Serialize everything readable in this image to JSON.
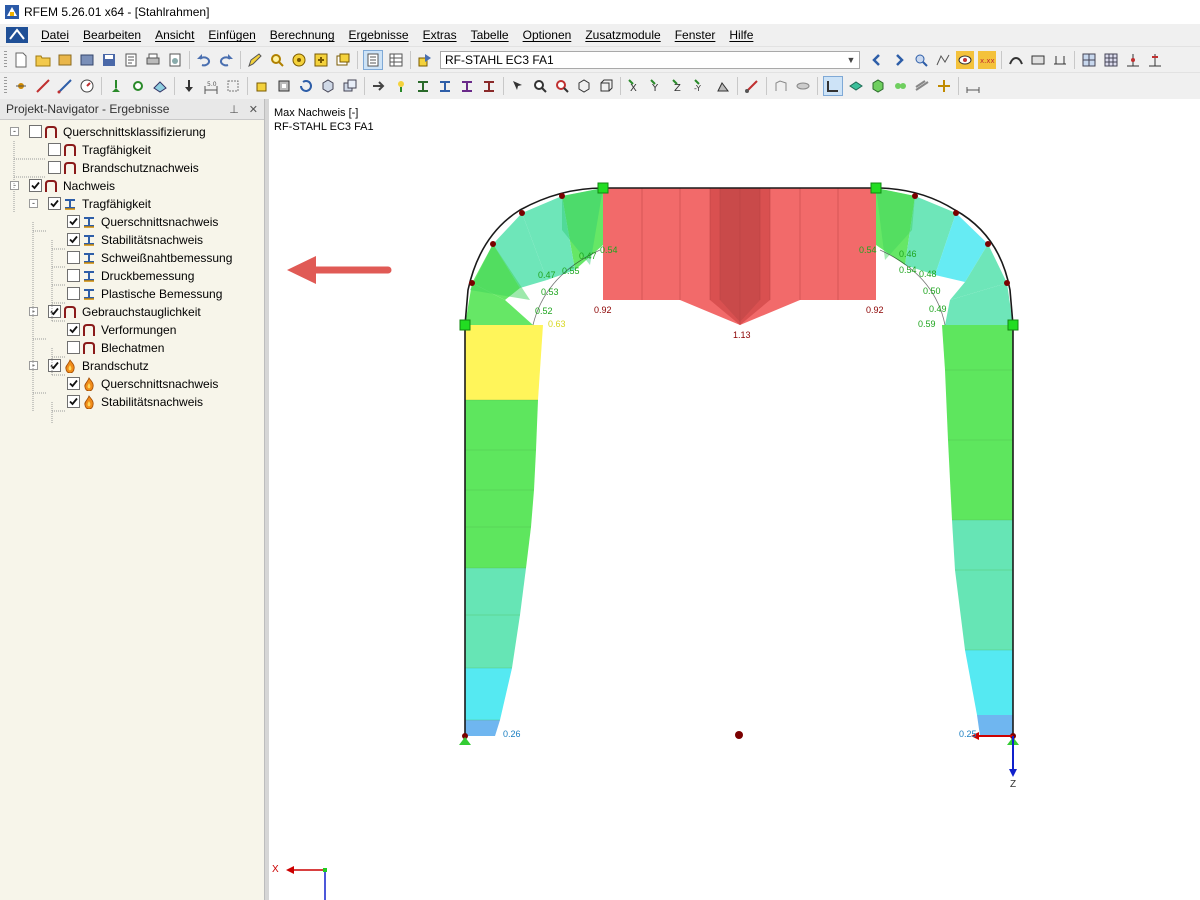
{
  "window": {
    "title": "RFEM 5.26.01 x64 - [Stahlrahmen]"
  },
  "menu": [
    "Datei",
    "Bearbeiten",
    "Ansicht",
    "Einfügen",
    "Berechnung",
    "Ergebnisse",
    "Extras",
    "Tabelle",
    "Optionen",
    "Zusatzmodule",
    "Fenster",
    "Hilfe"
  ],
  "toolbar": {
    "case_select": "RF-STAHL EC3 FA1"
  },
  "navigator": {
    "title": "Projekt-Navigator - Ergebnisse",
    "items": [
      {
        "label": "Querschnittsklassifizierung",
        "level": 0,
        "expander": "-",
        "checked": false,
        "icon": "frame-icon"
      },
      {
        "label": "Tragfähigkeit",
        "level": 1,
        "expander": "",
        "checked": false,
        "icon": "frame-icon"
      },
      {
        "label": "Brandschutznachweis",
        "level": 1,
        "expander": "",
        "checked": false,
        "icon": "frame-icon"
      },
      {
        "label": "Nachweis",
        "level": 0,
        "expander": "-",
        "checked": true,
        "icon": "frame-icon"
      },
      {
        "label": "Tragfähigkeit",
        "level": 1,
        "expander": "-",
        "checked": true,
        "icon": "beam-icon"
      },
      {
        "label": "Querschnittsnachweis",
        "level": 2,
        "expander": "",
        "checked": true,
        "icon": "beam-icon"
      },
      {
        "label": "Stabilitätsnachweis",
        "level": 2,
        "expander": "",
        "checked": true,
        "icon": "beam-icon"
      },
      {
        "label": "Schweißnahtbemessung",
        "level": 2,
        "expander": "",
        "checked": false,
        "icon": "beam-icon"
      },
      {
        "label": "Druckbemessung",
        "level": 2,
        "expander": "",
        "checked": false,
        "icon": "beam-icon"
      },
      {
        "label": "Plastische Bemessung",
        "level": 2,
        "expander": "",
        "checked": false,
        "icon": "beam-icon"
      },
      {
        "label": "Gebrauchstauglichkeit",
        "level": 1,
        "expander": "-",
        "checked": true,
        "icon": "frame-icon"
      },
      {
        "label": "Verformungen",
        "level": 2,
        "expander": "",
        "checked": true,
        "icon": "frame-icon"
      },
      {
        "label": "Blechatmen",
        "level": 2,
        "expander": "",
        "checked": false,
        "icon": "frame-icon"
      },
      {
        "label": "Brandschutz",
        "level": 1,
        "expander": "-",
        "checked": true,
        "icon": "flame-icon"
      },
      {
        "label": "Querschnittsnachweis",
        "level": 2,
        "expander": "",
        "checked": true,
        "icon": "flame-icon"
      },
      {
        "label": "Stabilitätsnachweis",
        "level": 2,
        "expander": "",
        "checked": true,
        "icon": "flame-icon"
      }
    ]
  },
  "view": {
    "heading": "Max Nachweis [-]",
    "subheading": "RF-STAHL EC3 FA1",
    "axis_z": "Z",
    "axis_x": "X",
    "result_labels": [
      "0.26",
      "0.25",
      "1.13",
      "0.92",
      "0.92",
      "0.63",
      "0.52",
      "0.53",
      "0.47",
      "0.55",
      "0.47",
      "0.54",
      "0.46",
      "0.48",
      "0.50",
      "0.49",
      "0.59",
      "0.54",
      "0.54"
    ]
  },
  "colors": {
    "red": "#f26a6a",
    "green": "#5ee65e",
    "teal": "#66e5b5",
    "cyan": "#55e9f2",
    "yellow": "#fff55a",
    "arrow": "#e05a55"
  }
}
